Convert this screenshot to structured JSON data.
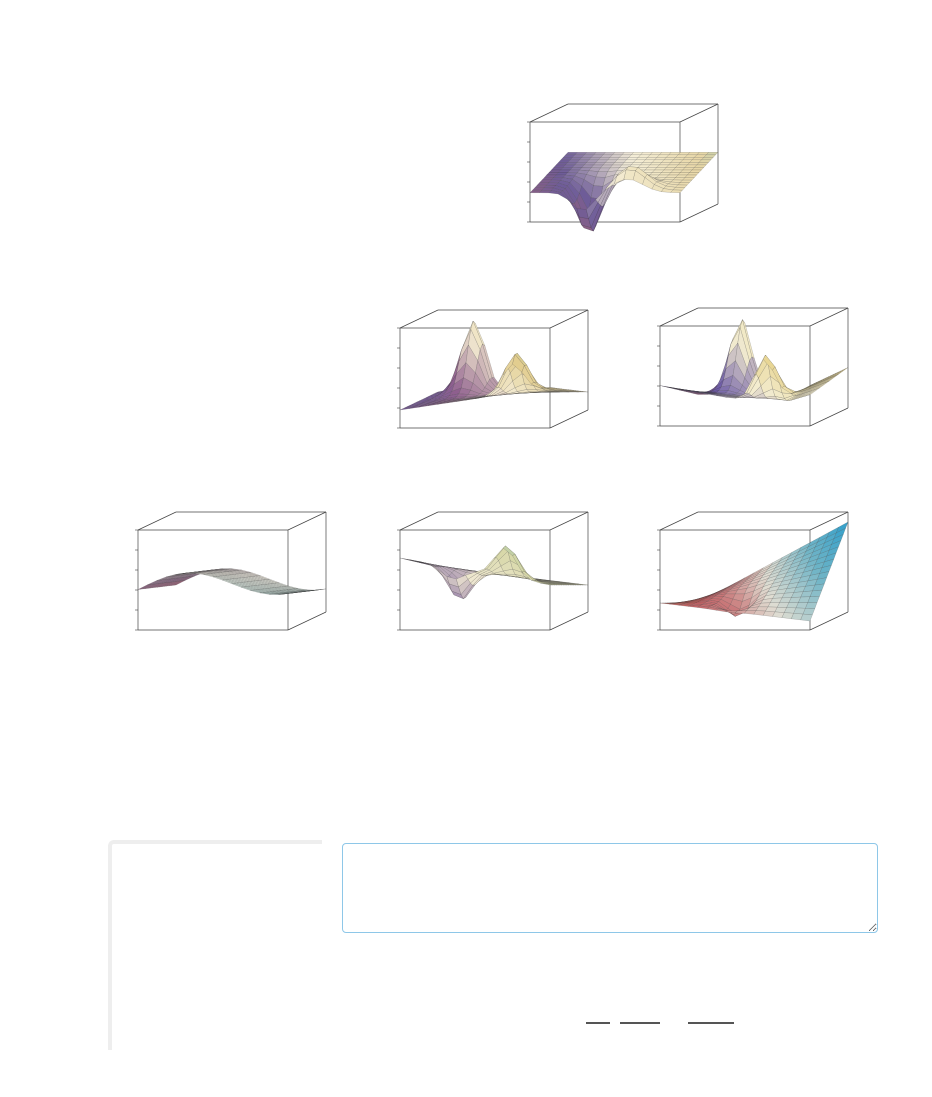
{
  "plots": [
    {
      "id": "plot-1",
      "surface": "dip-center",
      "colors": [
        "#b0626c",
        "#6e5c98",
        "#f5efd8",
        "#e8d7a6",
        "#5fb9b4"
      ]
    },
    {
      "id": "plot-2",
      "surface": "peak-back",
      "colors": [
        "#6b5aa8",
        "#8f5f8e",
        "#f2e9cf",
        "#e2cd8e",
        "#4db8b2"
      ]
    },
    {
      "id": "plot-3",
      "surface": "double-peak",
      "colors": [
        "#b05c73",
        "#6c5aa7",
        "#f3eccf",
        "#e6d28a",
        "#48b8a9"
      ]
    },
    {
      "id": "plot-4",
      "surface": "wave",
      "colors": [
        "#c05b64",
        "#8f6b8a",
        "#dcd8cf",
        "#9ccbc8",
        "#2fb8b3"
      ]
    },
    {
      "id": "plot-5",
      "surface": "saddle",
      "colors": [
        "#9c5a82",
        "#7a5c9b",
        "#efe8d1",
        "#d6d7a6",
        "#58a9a4"
      ]
    },
    {
      "id": "plot-6",
      "surface": "rising-corner",
      "colors": [
        "#e2694f",
        "#c46468",
        "#e0ddd2",
        "#6fb4c6",
        "#2f9ecb"
      ]
    }
  ],
  "input": {
    "value": ""
  }
}
